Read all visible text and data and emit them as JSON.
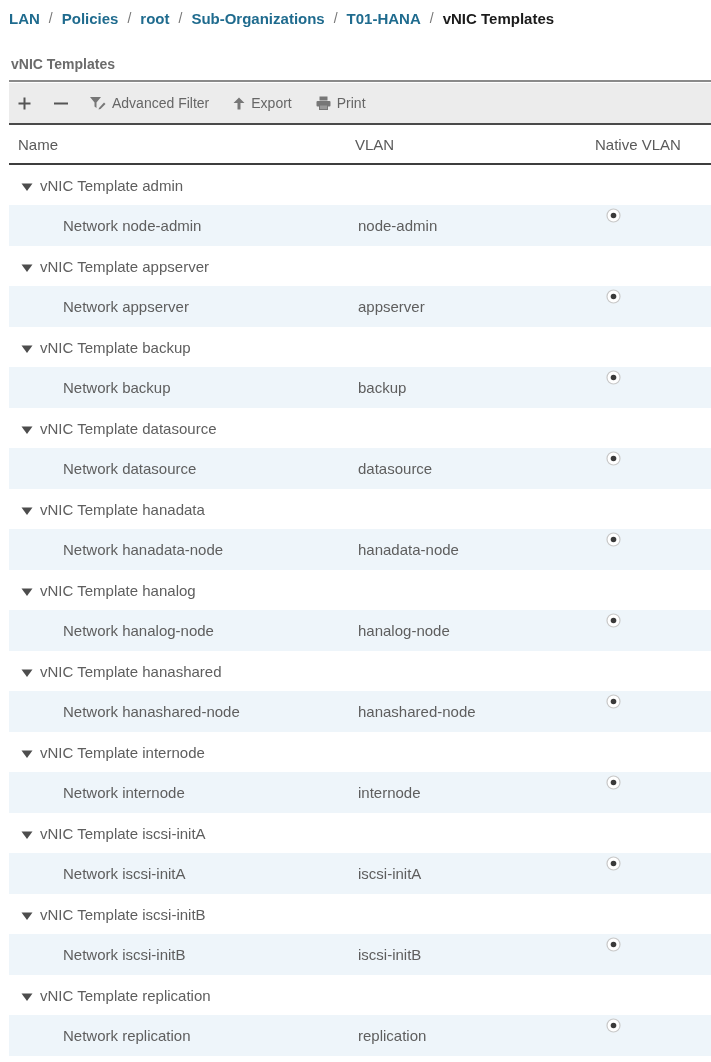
{
  "breadcrumb": {
    "separator": "/",
    "items": [
      {
        "label": "LAN",
        "current": false
      },
      {
        "label": "Policies",
        "current": false
      },
      {
        "label": "root",
        "current": false
      },
      {
        "label": "Sub-Organizations",
        "current": false
      },
      {
        "label": "T01-HANA",
        "current": false
      },
      {
        "label": "vNIC Templates",
        "current": true
      }
    ]
  },
  "panel": {
    "title": "vNIC Templates"
  },
  "toolbar": {
    "buttons": [
      {
        "label": "Advanced Filter"
      },
      {
        "label": "Export"
      },
      {
        "label": "Print"
      }
    ]
  },
  "table": {
    "columns": [
      "Name",
      "VLAN",
      "Native VLAN"
    ],
    "groups": [
      {
        "name": "vNIC Template admin",
        "expanded": true,
        "children": [
          {
            "name": "Network node-admin",
            "vlan": "node-admin",
            "native_vlan": true
          }
        ]
      },
      {
        "name": "vNIC Template appserver",
        "expanded": true,
        "children": [
          {
            "name": "Network appserver",
            "vlan": "appserver",
            "native_vlan": true
          }
        ]
      },
      {
        "name": "vNIC Template backup",
        "expanded": true,
        "children": [
          {
            "name": "Network backup",
            "vlan": "backup",
            "native_vlan": true
          }
        ]
      },
      {
        "name": "vNIC Template datasource",
        "expanded": true,
        "children": [
          {
            "name": "Network datasource",
            "vlan": "datasource",
            "native_vlan": true
          }
        ]
      },
      {
        "name": "vNIC Template hanadata",
        "expanded": true,
        "children": [
          {
            "name": "Network hanadata-node",
            "vlan": "hanadata-node",
            "native_vlan": true
          }
        ]
      },
      {
        "name": "vNIC Template hanalog",
        "expanded": true,
        "children": [
          {
            "name": "Network hanalog-node",
            "vlan": "hanalog-node",
            "native_vlan": true
          }
        ]
      },
      {
        "name": "vNIC Template hanashared",
        "expanded": true,
        "children": [
          {
            "name": "Network hanashared-node",
            "vlan": "hanashared-node",
            "native_vlan": true
          }
        ]
      },
      {
        "name": "vNIC Template internode",
        "expanded": true,
        "children": [
          {
            "name": "Network internode",
            "vlan": "internode",
            "native_vlan": true
          }
        ]
      },
      {
        "name": "vNIC Template iscsi-initA",
        "expanded": true,
        "children": [
          {
            "name": "Network iscsi-initA",
            "vlan": "iscsi-initA",
            "native_vlan": true
          }
        ]
      },
      {
        "name": "vNIC Template iscsi-initB",
        "expanded": true,
        "children": [
          {
            "name": "Network iscsi-initB",
            "vlan": "iscsi-initB",
            "native_vlan": true
          }
        ]
      },
      {
        "name": "vNIC Template replication",
        "expanded": true,
        "children": [
          {
            "name": "Network replication",
            "vlan": "replication",
            "native_vlan": true
          }
        ]
      }
    ]
  }
}
